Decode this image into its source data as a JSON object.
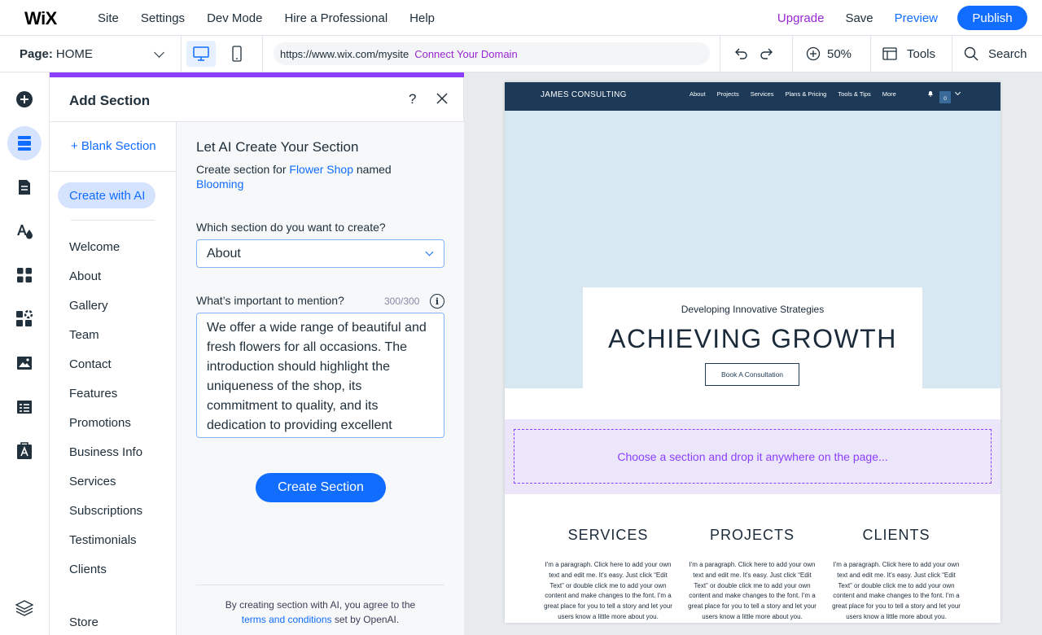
{
  "app": {
    "logo": "WiX",
    "menu": [
      "Site",
      "Settings",
      "Dev Mode",
      "Hire a Professional",
      "Help"
    ],
    "upgrade": "Upgrade",
    "save": "Save",
    "preview": "Preview",
    "publish": "Publish",
    "accent": "#116dff",
    "purple": "#9a27d5"
  },
  "toolbar": {
    "page_label": "Page:",
    "page_value": "HOME",
    "url": "https://www.wix.com/mysite",
    "connect_domain": "Connect Your Domain",
    "zoom": "50%",
    "tools": "Tools",
    "search": "Search"
  },
  "rail": {
    "icons": [
      "add-elements-icon",
      "add-section-icon",
      "pages-icon",
      "site-design-icon",
      "app-market-icon",
      "business-tools-icon",
      "media-icon",
      "cms-icon",
      "ascend-icon",
      "layers-icon"
    ]
  },
  "panel": {
    "title": "Add Section",
    "blank_section": "+ Blank Section",
    "create_with_ai": "Create with AI",
    "categories": [
      "Welcome",
      "About",
      "Gallery",
      "Team",
      "Contact",
      "Features",
      "Promotions",
      "Business Info",
      "Services",
      "Subscriptions",
      "Testimonials",
      "Clients"
    ],
    "store": "Store",
    "form": {
      "title": "Let AI Create Your Section",
      "sub_prefix": "Create section for",
      "business_type": "Flower Shop",
      "sub_mid": "named",
      "business_name": "Blooming",
      "q_section": "Which section do you want to create?",
      "selected_section": "About",
      "q_mention": "What’s important to mention?",
      "counter": "300/300",
      "mention_text": "We offer a wide range of beautiful and fresh flowers for all occasions. The introduction should highlight the uniqueness of the shop, its commitment to quality, and its dedication to providing excellent",
      "create_button": "Create Section",
      "disclaimer_prefix": "By creating section with AI, you agree to the",
      "terms": "terms and conditions",
      "disclaimer_suffix": "set by OpenAI."
    }
  },
  "site": {
    "logo": "JAMES CONSULTING",
    "nav": [
      "About",
      "Projects",
      "Services",
      "Plans & Pricing",
      "Tools & Tips",
      "More"
    ],
    "cart_count": "0",
    "hero_subtitle": "Developing Innovative Strategies",
    "hero_title": "ACHIEVING GROWTH",
    "hero_button": "Book A Consultation",
    "drop_hint": "Choose a section and drop it anywhere on the page...",
    "columns": [
      {
        "title": "SERVICES",
        "text": "I'm a paragraph. Click here to add your own text and edit me. It's easy. Just click “Edit Text” or double click me to add your own content and make changes to the font. I'm a great place for you to tell a story and let your users know a little more about you."
      },
      {
        "title": "PROJECTS",
        "text": "I'm a paragraph. Click here to add your own text and edit me. It's easy. Just click “Edit Text” or double click me to add your own content and make changes to the font. I'm a great place for you to tell a story and let your users know a little more about you."
      },
      {
        "title": "CLIENTS",
        "text": "I'm a paragraph. Click here to add your own text and edit me. It's easy. Just click “Edit Text” or double click me to add your own content and make changes to the font. I'm a great place for you to tell a story and let your users know a little more about you."
      }
    ]
  }
}
